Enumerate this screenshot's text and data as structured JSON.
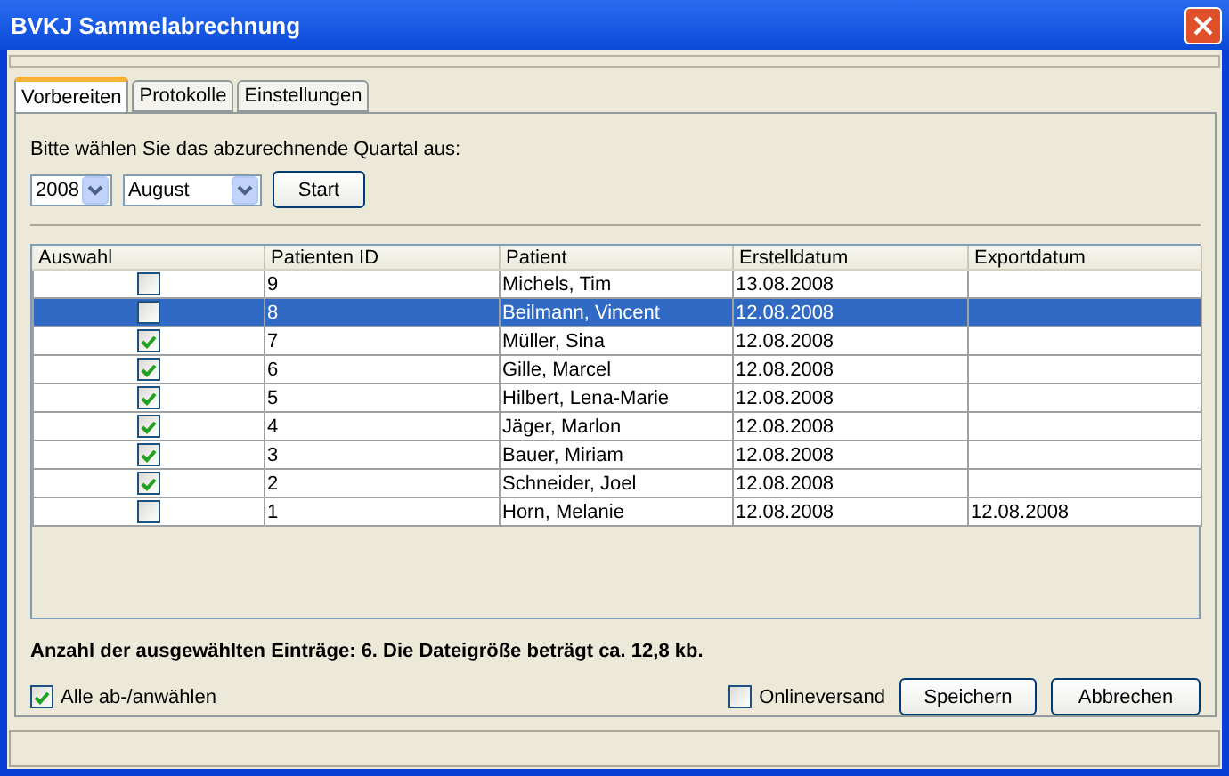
{
  "window": {
    "title": "BVKJ Sammelabrechnung"
  },
  "tabs": [
    {
      "label": "Vorbereiten",
      "selected": true
    },
    {
      "label": "Protokolle",
      "selected": false
    },
    {
      "label": "Einstellungen",
      "selected": false
    }
  ],
  "prompt": "Bitte wählen Sie das abzurechnende Quartal aus:",
  "year": "2008",
  "month": "August",
  "start_button": "Start",
  "table": {
    "columns": [
      "Auswahl",
      "Patienten ID",
      "Patient",
      "Erstelldatum",
      "Exportdatum"
    ],
    "rows": [
      {
        "checked": false,
        "selected": false,
        "id": "9",
        "patient": "Michels, Tim",
        "created": "13.08.2008",
        "exported": ""
      },
      {
        "checked": false,
        "selected": true,
        "id": "8",
        "patient": "Beilmann, Vincent",
        "created": "12.08.2008",
        "exported": ""
      },
      {
        "checked": true,
        "selected": false,
        "id": "7",
        "patient": "Müller, Sina",
        "created": "12.08.2008",
        "exported": ""
      },
      {
        "checked": true,
        "selected": false,
        "id": "6",
        "patient": "Gille, Marcel",
        "created": "12.08.2008",
        "exported": ""
      },
      {
        "checked": true,
        "selected": false,
        "id": "5",
        "patient": "Hilbert, Lena-Marie",
        "created": "12.08.2008",
        "exported": ""
      },
      {
        "checked": true,
        "selected": false,
        "id": "4",
        "patient": "Jäger, Marlon",
        "created": "12.08.2008",
        "exported": ""
      },
      {
        "checked": true,
        "selected": false,
        "id": "3",
        "patient": "Bauer, Miriam",
        "created": "12.08.2008",
        "exported": ""
      },
      {
        "checked": true,
        "selected": false,
        "id": "2",
        "patient": "Schneider, Joel",
        "created": "12.08.2008",
        "exported": ""
      },
      {
        "checked": false,
        "selected": false,
        "id": "1",
        "patient": "Horn, Melanie",
        "created": "12.08.2008",
        "exported": "12.08.2008"
      }
    ]
  },
  "summary": "Anzahl der ausgewählten Einträge: 6. Die Dateigröße beträgt ca. 12,8 kb.",
  "select_all": {
    "label": "Alle ab-/anwählen",
    "checked": true
  },
  "online": {
    "label": "Onlineversand",
    "checked": false
  },
  "buttons": [
    "Speichern",
    "Abbrechen"
  ]
}
